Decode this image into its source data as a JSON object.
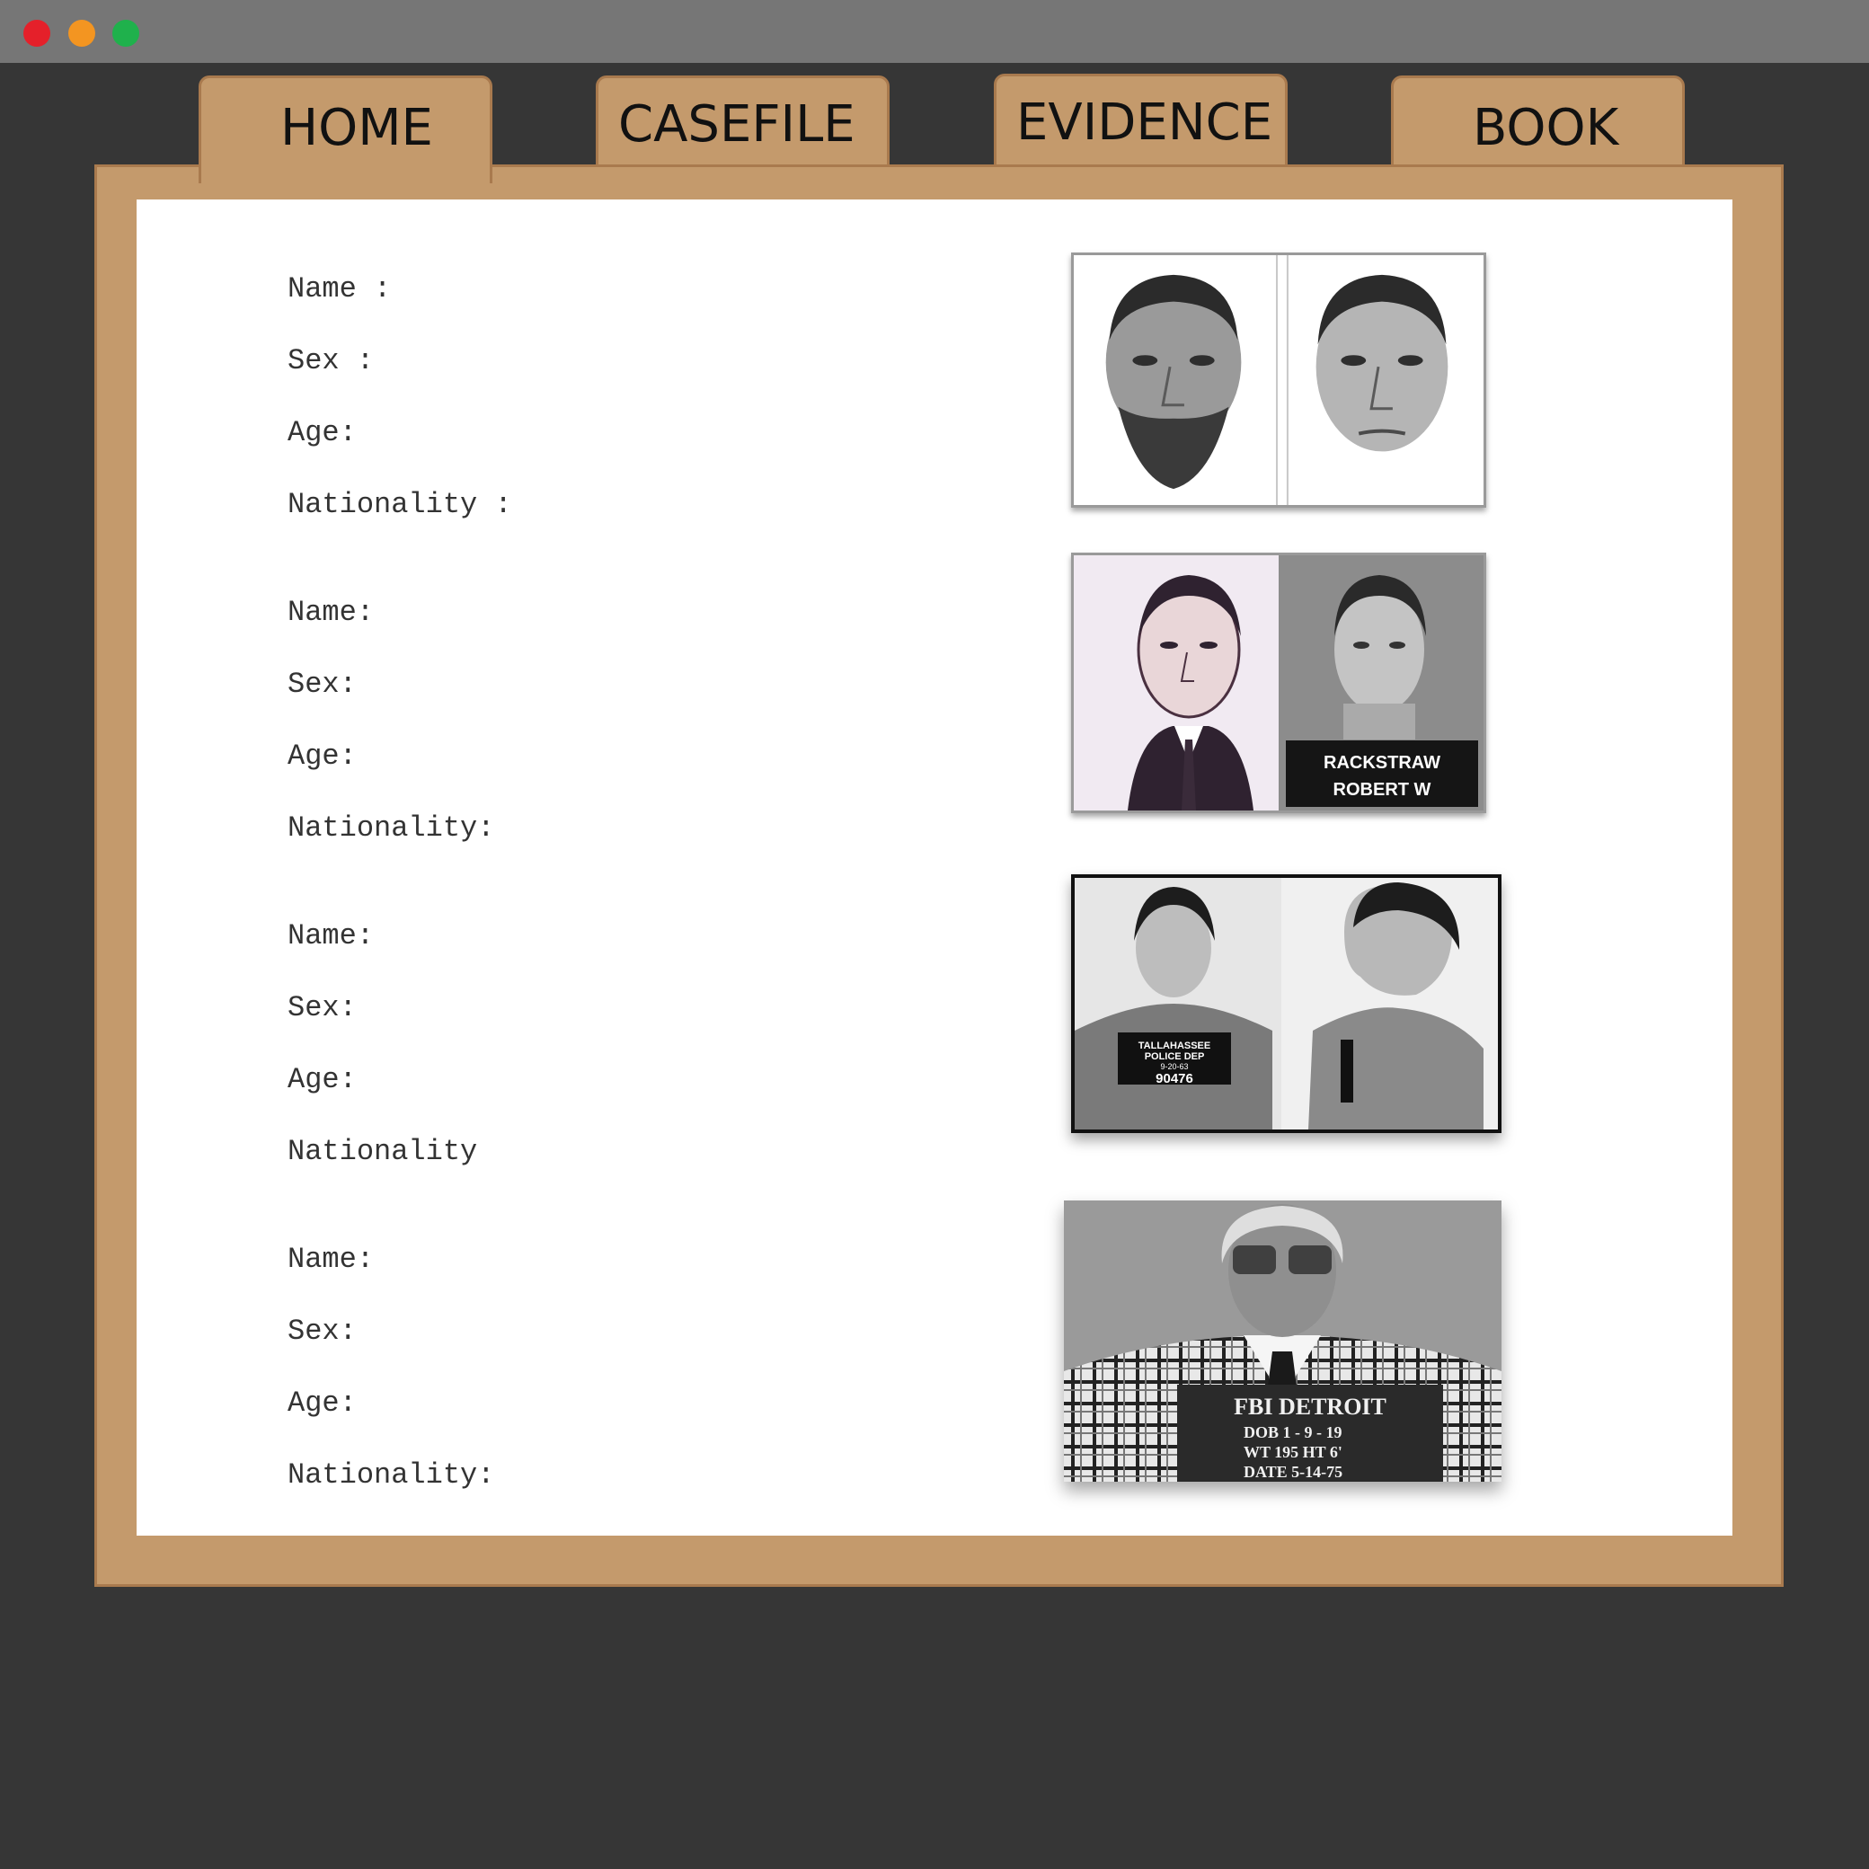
{
  "window": {
    "controls": [
      "close",
      "minimize",
      "maximize"
    ],
    "control_colors": {
      "close": "#e5202a",
      "minimize": "#f39521",
      "maximize": "#1fb14c"
    }
  },
  "tabs": [
    {
      "label": "HOME",
      "active": true
    },
    {
      "label": "CASEFILE",
      "active": false
    },
    {
      "label": "EVIDENCE",
      "active": false
    },
    {
      "label": "BOOK",
      "active": false
    }
  ],
  "colors": {
    "folder": "#c49a6c",
    "background": "#363636",
    "sheet": "#ffffff"
  },
  "suspects": [
    {
      "fields": [
        "Name :",
        "Sex :",
        "Age:",
        "Nationality :"
      ],
      "photo": {
        "kind": "composite sketches, bearded and clean-shaven"
      }
    },
    {
      "fields": [
        "Name:",
        "Sex:",
        "Age:",
        "Nationality:"
      ],
      "photo": {
        "kind": "sketch and mugshot",
        "placard": [
          "RACKSTRAW",
          "ROBERT  W"
        ]
      }
    },
    {
      "fields": [
        "Name:",
        "Sex:",
        "Age:",
        "Nationality"
      ],
      "photo": {
        "kind": "mugshot front and profile",
        "placard": [
          "TALLAHASSEE",
          "POLICE DEP",
          "9-20-63",
          "90476"
        ]
      }
    },
    {
      "fields": [
        "Name:",
        "Sex:",
        "Age:",
        "Nationality:"
      ],
      "photo": {
        "kind": "mugshot with placard",
        "placard": [
          "FBI  DETROIT",
          "DOB 1 - 9 - 19",
          "WT 195   HT 6'",
          "DATE 5-14-75"
        ]
      }
    }
  ]
}
